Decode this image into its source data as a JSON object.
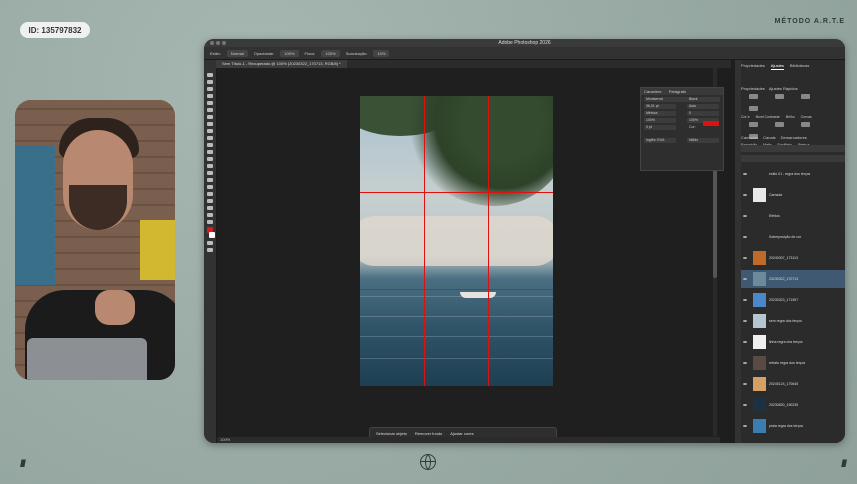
{
  "overlay": {
    "id_label": "ID: 135797832",
    "brand": "MÉTODO A.R.T.E",
    "deco_left": "/////",
    "deco_right": "/////"
  },
  "photoshop": {
    "app_title": "Adobe Photoshop 2026",
    "doc_tab": "Sem Título-1 - Recuperado @ 100% (20230322_170713, RGB/8) *",
    "options": [
      "Estilo:",
      "Normal",
      "Opacidade:",
      "100%",
      "Fluxo:",
      "100%",
      "Suavização:",
      "10%"
    ],
    "status": "100%",
    "context_bar": [
      "Selecionar objeto",
      "Remover fundo",
      "Ajustar cores"
    ],
    "character_panel": {
      "tabs": [
        "Caractere",
        "Parágrafo"
      ],
      "font": "Montserrat",
      "style": "Black",
      "fields": [
        "36,01 pt",
        "Auto",
        "Métrica",
        "0",
        "100%",
        "100%",
        "0 pt",
        "Cor:"
      ],
      "lang": "Inglês: EUA",
      "aa": "Nítido",
      "text_color": "#e01010"
    },
    "right_tabs": [
      "Propriedades",
      "Ajustes",
      "Bibliotecas"
    ],
    "adjustments": [
      "Propriedades",
      "Ajustes Rápidos",
      "Cor e",
      "Nível Contraste",
      "Brilho",
      "Curvas",
      "Exposição",
      "Matiz",
      "Equilíbrio",
      "Preto e"
    ],
    "layers_tabs": [
      "Camadas",
      "Canais",
      "Demarcadores"
    ],
    "layers": [
      {
        "name": "estilo 01 - regra dos terços",
        "thumb": "#2b2b2b",
        "selected": false
      },
      {
        "name": "Camada",
        "thumb": "#e8e8e8",
        "selected": false
      },
      {
        "name": "Efeitos",
        "thumb": "#2b2b2b",
        "selected": false
      },
      {
        "name": "Sobreposição de cor",
        "thumb": "#2b2b2b",
        "selected": false
      },
      {
        "name": "20240307_173113",
        "thumb": "#c06a2a",
        "selected": false
      },
      {
        "name": "20230322_170713",
        "thumb": "#6d8a9a",
        "selected": true
      },
      {
        "name": "20230323_171957",
        "thumb": "#4a88c8",
        "selected": false
      },
      {
        "name": "sem regra dos terços",
        "thumb": "#b5c6d0",
        "selected": false
      },
      {
        "name": "linha regra dos terços",
        "thumb": "#f0f0f0",
        "selected": false
      },
      {
        "name": "retrato regra dos terços",
        "thumb": "#5a4a44",
        "selected": false
      },
      {
        "name": "20240124_170645",
        "thumb": "#d4a064",
        "selected": false
      },
      {
        "name": "20230830_190235",
        "thumb": "#1d3142",
        "selected": false
      },
      {
        "name": "praia regra dos terços",
        "thumb": "#3a7db0",
        "selected": false
      }
    ]
  }
}
